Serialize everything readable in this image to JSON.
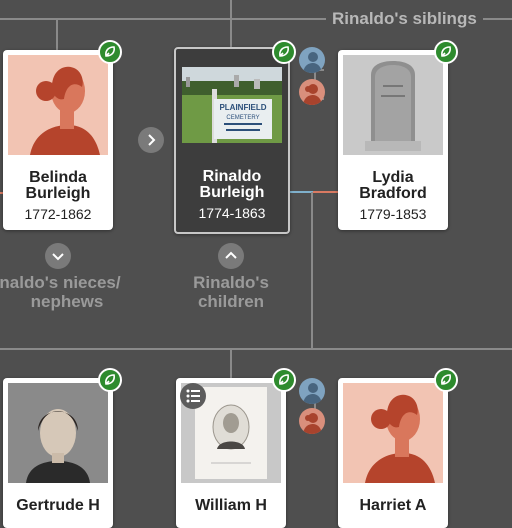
{
  "top": {
    "siblings_label": "Rinaldo's siblings"
  },
  "cards": [
    {
      "first": "Belinda",
      "last": "Burleigh",
      "dates": "1772-1862"
    },
    {
      "first": "Rinaldo",
      "last": "Burleigh",
      "dates": "1774-1863"
    },
    {
      "first": "Lydia",
      "last": "Bradford",
      "dates": "1779-1853"
    }
  ],
  "bottom_cards": [
    {
      "name": "Gertrude H"
    },
    {
      "name": "William H"
    },
    {
      "name": "Harriet A"
    }
  ],
  "sections": {
    "nieces_line1": "naldo's nieces/",
    "nieces_line2": "nephews",
    "children_line1": "Rinaldo's",
    "children_line2": "children"
  },
  "photo_text": {
    "sign_line1": "PLAINFIELD",
    "sign_line2": "CEMETERY"
  },
  "colors": {
    "background": "#4f4f4f",
    "hint_green": "#2e8b2e",
    "male_blue": "#7fb0cc",
    "female_red": "#d97a62"
  },
  "icons": [
    "leaf-hint-icon",
    "chevron-right-icon",
    "chevron-down-icon",
    "chevron-up-icon",
    "list-icon",
    "male-avatar-icon",
    "female-avatar-icon"
  ]
}
